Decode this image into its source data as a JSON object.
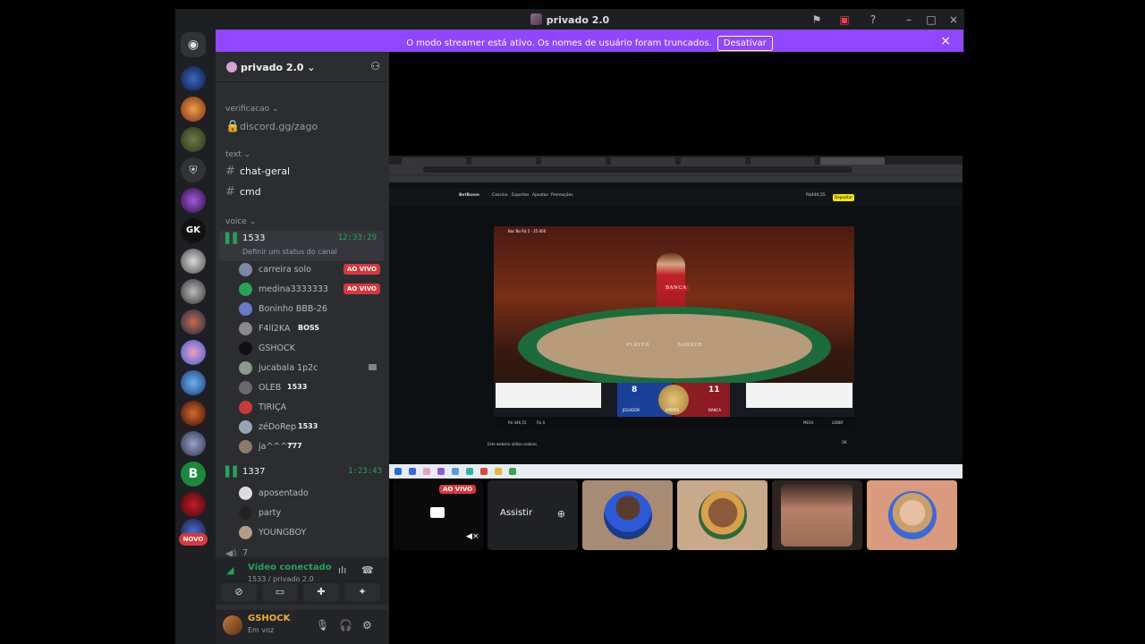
{
  "window": {
    "title": "privado 2.0"
  },
  "banner": {
    "message": "O modo streamer está ativo. Os nomes de usuário foram truncados.",
    "button": "Desativar"
  },
  "rail": {
    "badge": "NOVO",
    "gk_label": "GK",
    "b_label": "B"
  },
  "server": {
    "name": "privado 2.0"
  },
  "categories": {
    "verificacao": "verificacao",
    "text": "text",
    "voice": "voice"
  },
  "channels": {
    "invite": "discord.gg/zago",
    "chat_geral": "chat-geral",
    "cmd": "cmd"
  },
  "voice1": {
    "name": "1533",
    "timer": "12:33:29",
    "status": "Definir um status do canal",
    "users": [
      {
        "name": "carreira solo",
        "live": "AO VIVO"
      },
      {
        "name": "medina3333333",
        "live": "AO VIVO"
      },
      {
        "name": "Boninho BBB-26"
      },
      {
        "name": "F4ll2KA",
        "badge": "BOSS"
      },
      {
        "name": "GSHOCK"
      },
      {
        "name": "jucabala 1p2c"
      },
      {
        "name": "OLEB",
        "badge": "1533"
      },
      {
        "name": "TIRIÇA"
      },
      {
        "name": "zéDoRep",
        "badge": "1533"
      },
      {
        "name": "ja^^^^",
        "badge": "777"
      }
    ]
  },
  "voice2": {
    "name": "1337",
    "timer": "1:23:43",
    "users": [
      {
        "name": "aposentado"
      },
      {
        "name": "party"
      },
      {
        "name": "YOUNGBOY"
      }
    ]
  },
  "voice3": {
    "name": "7"
  },
  "panel": {
    "connected": "Vídeo conectado",
    "sub": "1533 / privado 2.0"
  },
  "userbar": {
    "name": "GSHOCK",
    "status": "Em voz"
  },
  "stream": {
    "site_logo": "BetBoom",
    "nav": [
      "Cassino",
      "Esportes",
      "Apostas",
      "Promoções"
    ],
    "balance": "R$446,55",
    "deposit": "Depositar",
    "table_title": "Bac Bo R$ 5 - 25.000",
    "banca": "BANCA",
    "player_label": "PLAYER",
    "banker_label": "BANKER",
    "player_score": "8",
    "banker_score": "11",
    "player_name": "JOGADOR",
    "banker_name": "BANCA",
    "tie_name": "EMPATE",
    "saldo": "R$ 446,55",
    "aposta": "R$ 0",
    "mesa": "MESA",
    "lobby": "LOBBY",
    "cookie": "Este website utiliza cookies.",
    "ok": "OK"
  },
  "tiles": {
    "live": "AO VIVO",
    "watch": "Assistir"
  },
  "colors": {
    "accent": "#9146ff",
    "live": "#da373c",
    "green": "#23a55a",
    "bg": "#1e1f22"
  }
}
